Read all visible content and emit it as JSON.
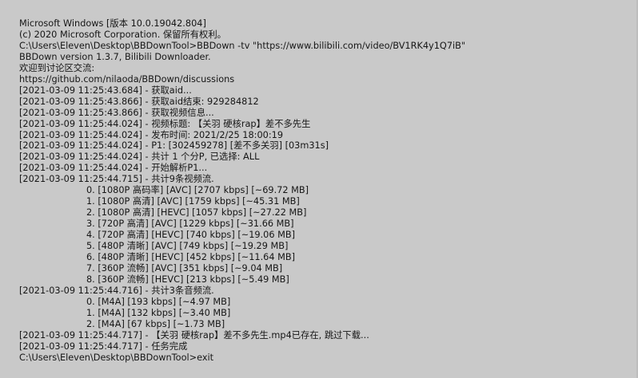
{
  "console": {
    "lines": [
      "Microsoft Windows [版本 10.0.19042.804]",
      "(c) 2020 Microsoft Corporation. 保留所有权利。",
      "C:\\Users\\Eleven\\Desktop\\BBDownTool>BBDown -tv \"https://www.bilibili.com/video/BV1RK4y1Q7iB\"",
      "BBDown version 1.3.7, Bilibili Downloader.",
      "欢迎到讨论区交流:",
      "https://github.com/nilaoda/BBDown/discussions",
      "[2021-03-09 11:25:43.684] - 获取aid...",
      "[2021-03-09 11:25:43.866] - 获取aid结束: 929284812",
      "[2021-03-09 11:25:43.866] - 获取视频信息...",
      "[2021-03-09 11:25:44.024] - 视频标题: 【关羽 硬核rap】差不多先生",
      "[2021-03-09 11:25:44.024] - 发布时间: 2021/2/25 18:00:19",
      "[2021-03-09 11:25:44.024] - P1: [302459278] [差不多关羽] [03m31s]",
      "[2021-03-09 11:25:44.024] - 共计 1 个分P, 已选择: ALL",
      "[2021-03-09 11:25:44.024] - 开始解析P1...",
      "[2021-03-09 11:25:44.715] - 共计9条视频流.",
      "0. [1080P 高码率] [AVC] [2707 kbps] [~69.72 MB]",
      "1. [1080P 高清] [AVC] [1759 kbps] [~45.31 MB]",
      "2. [1080P 高清] [HEVC] [1057 kbps] [~27.22 MB]",
      "3. [720P 高清] [AVC] [1229 kbps] [~31.66 MB]",
      "4. [720P 高清] [HEVC] [740 kbps] [~19.06 MB]",
      "5. [480P 清晰] [AVC] [749 kbps] [~19.29 MB]",
      "6. [480P 清晰] [HEVC] [452 kbps] [~11.64 MB]",
      "7. [360P 流畅] [AVC] [351 kbps] [~9.04 MB]",
      "8. [360P 流畅] [HEVC] [213 kbps] [~5.49 MB]",
      "[2021-03-09 11:25:44.716] - 共计3条音频流.",
      "0. [M4A] [193 kbps] [~4.97 MB]",
      "1. [M4A] [132 kbps] [~3.40 MB]",
      "2. [M4A] [67 kbps] [~1.73 MB]",
      "[2021-03-09 11:25:44.717] - 【关羽 硬核rap】差不多先生.mp4已存在, 跳过下载...",
      "[2021-03-09 11:25:44.717] - 任务完成",
      "C:\\Users\\Eleven\\Desktop\\BBDownTool>exit"
    ]
  }
}
